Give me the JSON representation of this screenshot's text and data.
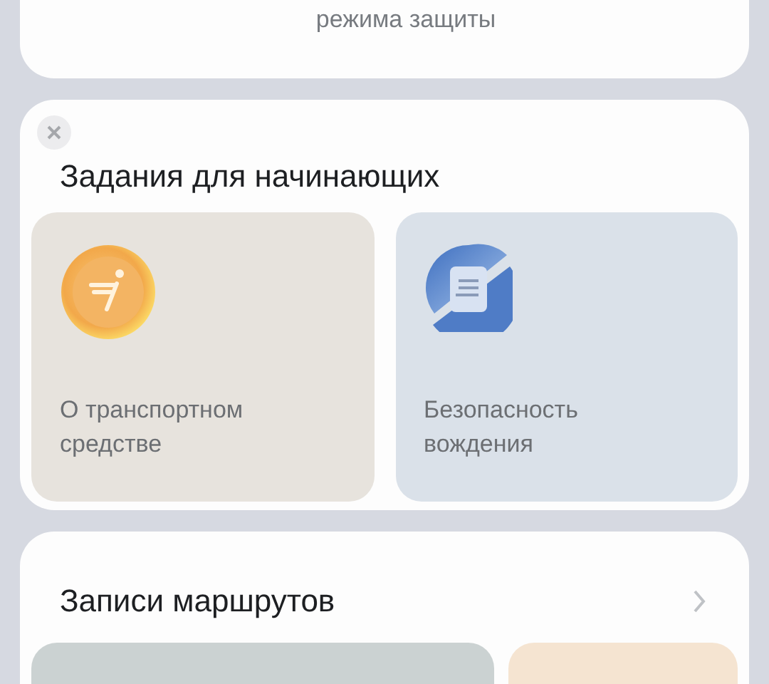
{
  "top_card": {
    "caption": "режима защиты"
  },
  "beginner_tasks": {
    "title": "Задания для начинающих",
    "tiles": [
      {
        "kind": "vehicle",
        "label": "О транспортном средстве"
      },
      {
        "kind": "safety",
        "label": "Безопасность вождения"
      }
    ]
  },
  "route_records": {
    "title": "Записи маршрутов"
  }
}
